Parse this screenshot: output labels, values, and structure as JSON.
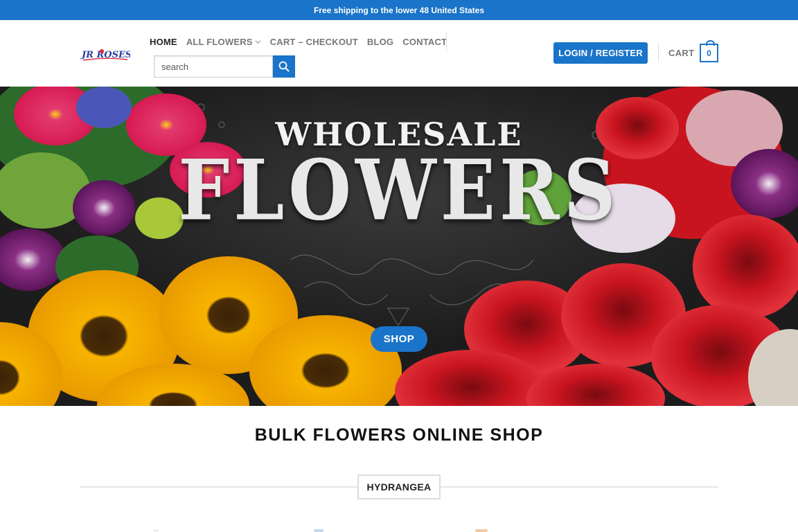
{
  "topbar": {
    "text": "Free shipping to the lower 48 United States"
  },
  "logo": {
    "text": "JR ROSES"
  },
  "nav": {
    "items": [
      {
        "label": "HOME",
        "active": true
      },
      {
        "label": "ALL FLOWERS",
        "has_dropdown": true
      },
      {
        "label": "CART – CHECKOUT"
      },
      {
        "label": "BLOG"
      },
      {
        "label": "CONTACT"
      }
    ]
  },
  "search": {
    "placeholder": "search",
    "icon": "search-icon"
  },
  "account": {
    "login_label": "LOGIN / REGISTER"
  },
  "cart": {
    "label": "CART",
    "count": "0"
  },
  "hero": {
    "title_line1": "WHOLESALE",
    "title_line2": "FLOWERS",
    "button_label": "SHOP"
  },
  "main": {
    "section_title": "BULK FLOWERS ONLINE SHOP",
    "category_tag": "HYDRANGEA"
  },
  "colors": {
    "accent": "#1a74c9",
    "topbar_bg": "#1a74c9",
    "text_dark": "#111111",
    "nav_muted": "#777777"
  }
}
